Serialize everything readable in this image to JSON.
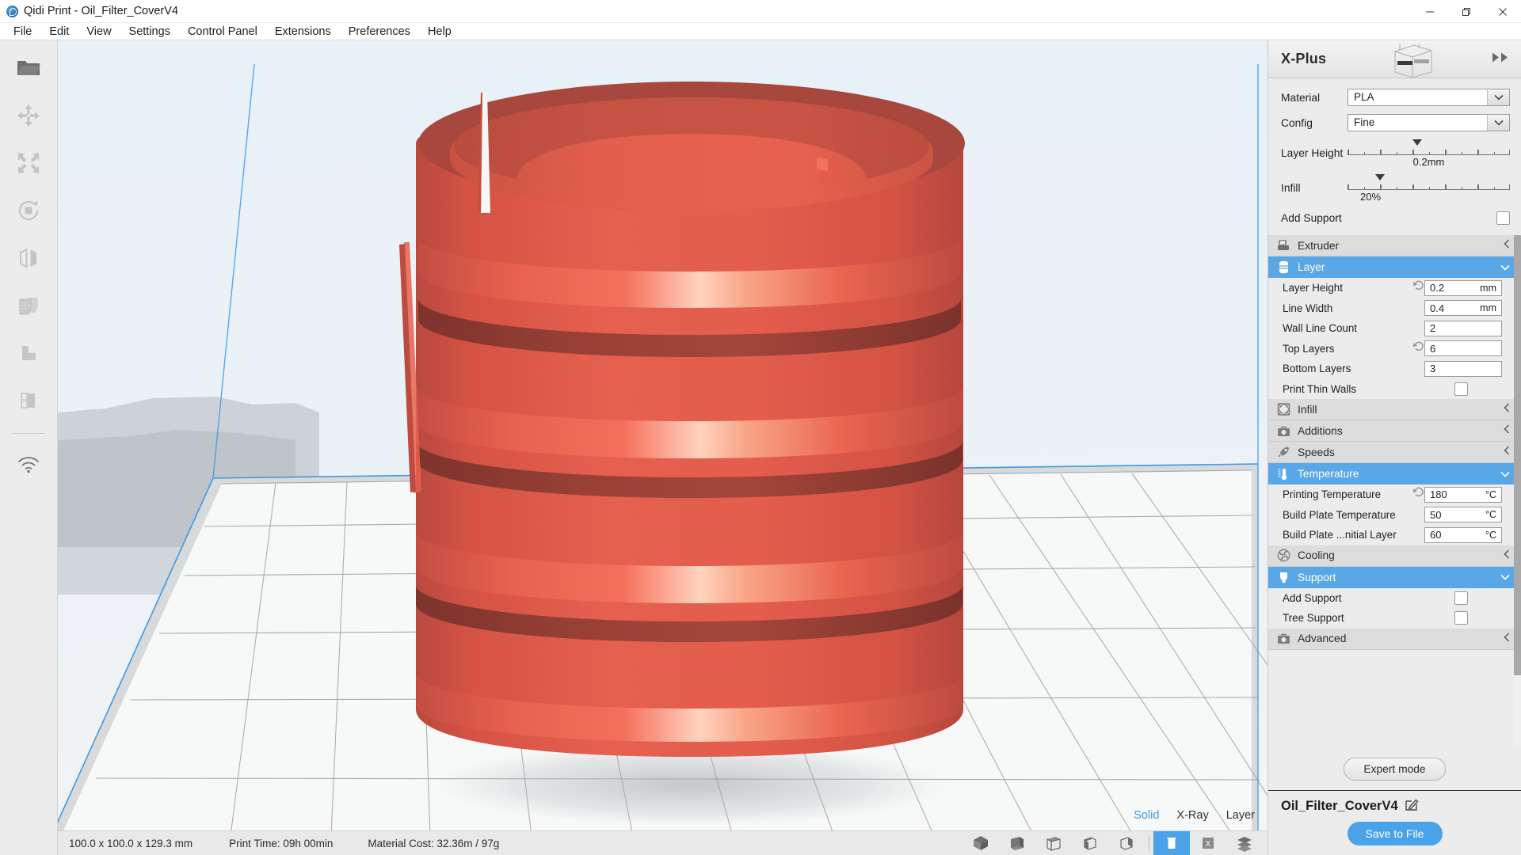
{
  "window": {
    "app_icon": "qidi-logo-icon",
    "title": "Qidi Print - Oil_Filter_CoverV4",
    "controls": [
      {
        "name": "minimize",
        "glyph": "minimize-icon"
      },
      {
        "name": "maximize",
        "glyph": "maximize-icon"
      },
      {
        "name": "close",
        "glyph": "close-icon"
      }
    ]
  },
  "menubar": {
    "items": [
      "File",
      "Edit",
      "View",
      "Settings",
      "Control Panel",
      "Extensions",
      "Preferences",
      "Help"
    ]
  },
  "left_toolbar": {
    "tools": [
      {
        "name": "open-file-icon",
        "title": "Open File"
      },
      {
        "name": "move-icon",
        "title": "Move"
      },
      {
        "name": "scale-icon",
        "title": "Scale"
      },
      {
        "name": "rotate-icon",
        "title": "Rotate"
      },
      {
        "name": "mirror-icon",
        "title": "Mirror"
      },
      {
        "name": "per-model-settings-icon",
        "title": "Per Model Settings"
      },
      {
        "name": "support-blocker-icon",
        "title": "Support Blocker"
      },
      {
        "name": "support-eraser-icon",
        "title": "Support Eraser"
      },
      {
        "name": "wifi-icon",
        "title": "Wireless Connection"
      }
    ]
  },
  "viewport": {
    "model_color": "#e2584a",
    "model_shadow_color": "#a8473e",
    "plate_color": "#f7f7f7",
    "plate_outline_color": "#3c9ae6",
    "background_top": "#eaf2f8",
    "background_bottom": "#f1f4f6",
    "view_modes": [
      {
        "label": "Solid",
        "active": true
      },
      {
        "label": "X-Ray",
        "active": false
      },
      {
        "label": "Layer",
        "active": false
      }
    ]
  },
  "statusbar": {
    "dimensions": "100.0 x 100.0 x 129.3 mm",
    "print_time": "Print Time: 09h 00min",
    "material_cost": "Material Cost: 32.36m / 97g",
    "camera_buttons": [
      {
        "name": "view-3d-icon"
      },
      {
        "name": "view-front-icon"
      },
      {
        "name": "view-top-icon"
      },
      {
        "name": "view-left-icon"
      },
      {
        "name": "view-right-icon"
      }
    ],
    "render_buttons": [
      {
        "name": "view-solid-icon",
        "selected": true
      },
      {
        "name": "view-xray-icon",
        "selected": false
      },
      {
        "name": "view-layer-icon",
        "selected": false
      }
    ]
  },
  "right_panel": {
    "printer_name": "X-Plus",
    "printer_image": "printer-thumbnail-icon",
    "collapse_icon": "double-chevron-right-icon",
    "quick_settings": {
      "material": {
        "label": "Material",
        "value": "PLA"
      },
      "config": {
        "label": "Config",
        "value": "Fine"
      },
      "layer_height": {
        "label": "Layer Height",
        "value": "0.2mm",
        "position_pct": 43
      },
      "infill": {
        "label": "Infill",
        "value": "20%",
        "position_pct": 20
      },
      "add_support": {
        "label": "Add Support",
        "checked": false
      }
    },
    "sections": [
      {
        "name": "Extruder",
        "icon": "extruder-icon",
        "open": false,
        "rows": []
      },
      {
        "name": "Layer",
        "icon": "layer-icon",
        "open": true,
        "rows": [
          {
            "label": "Layer Height",
            "type": "field",
            "value": "0.2",
            "unit": "mm",
            "revert": true
          },
          {
            "label": "Line Width",
            "type": "field",
            "value": "0.4",
            "unit": "mm",
            "revert": false
          },
          {
            "label": "Wall Line Count",
            "type": "field",
            "value": "2",
            "unit": "",
            "revert": false
          },
          {
            "label": "Top Layers",
            "type": "field",
            "value": "6",
            "unit": "",
            "revert": true
          },
          {
            "label": "Bottom Layers",
            "type": "field",
            "value": "3",
            "unit": "",
            "revert": false
          },
          {
            "label": "Print Thin Walls",
            "type": "check",
            "checked": false
          }
        ]
      },
      {
        "name": "Infill",
        "icon": "infill-icon",
        "open": false,
        "rows": []
      },
      {
        "name": "Additions",
        "icon": "additions-icon",
        "open": false,
        "rows": []
      },
      {
        "name": "Speeds",
        "icon": "speeds-icon",
        "open": false,
        "rows": []
      },
      {
        "name": "Temperature",
        "icon": "temperature-icon",
        "open": true,
        "rows": [
          {
            "label": "Printing Temperature",
            "type": "field",
            "value": "180",
            "unit": "°C",
            "revert": true
          },
          {
            "label": "Build Plate Temperature",
            "type": "field",
            "value": "50",
            "unit": "°C",
            "revert": false
          },
          {
            "label": "Build Plate ...nitial Layer",
            "type": "field",
            "value": "60",
            "unit": "°C",
            "revert": false
          }
        ]
      },
      {
        "name": "Cooling",
        "icon": "cooling-icon",
        "open": false,
        "rows": []
      },
      {
        "name": "Support",
        "icon": "support-icon",
        "open": true,
        "rows": [
          {
            "label": "Add Support",
            "type": "check",
            "checked": false
          },
          {
            "label": "Tree Support",
            "type": "check",
            "checked": false
          }
        ]
      },
      {
        "name": "Advanced",
        "icon": "advanced-icon",
        "open": false,
        "rows": []
      }
    ],
    "expert_mode_label": "Expert mode",
    "footer": {
      "filename": "Oil_Filter_CoverV4",
      "edit_icon": "edit-pencil-icon",
      "save_label": "Save to File",
      "save_color": "#4aa3e8"
    }
  }
}
